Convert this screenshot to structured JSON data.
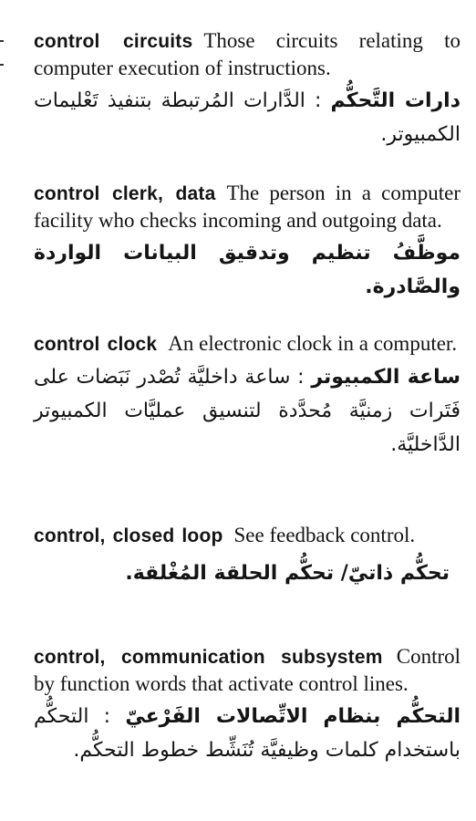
{
  "entries": [
    {
      "term": "control circuits",
      "definition": "Those circuits relating to computer execution of instructions.",
      "arabic_term": "دارات التَّحكُّم",
      "arabic_separator": " : ",
      "arabic_definition": "الدَّارات المُرتبطة بتنفيذ تَعْليمات الكمبيوتر."
    },
    {
      "term": "control clerk, data",
      "definition": "The person in a computer facility who checks incoming and outgoing data.",
      "arabic_term": "",
      "arabic_separator": "",
      "arabic_definition": "موظَّفُ تنظيم وتدقيق البيانات الواردة والصَّادرة."
    },
    {
      "term": "control clock",
      "definition": "An electronic clock in a computer.",
      "arabic_term": "ساعة الكمبيوتر",
      "arabic_separator": " : ",
      "arabic_definition": "ساعة داخليَّة تُصْدر نَبَضات على فَتَرات زمنيَّة مُحدَّدة لتنسيق عمليَّات الكمبيوتر الدَّاخليَّة."
    },
    {
      "term": "control, closed loop",
      "definition": "See feedback control.",
      "arabic_term": "",
      "arabic_separator": "",
      "arabic_definition": "تحكُّم ذاتيّ/ تحكُّم الحلقة المُغْلقة."
    },
    {
      "term": "control, communication subsystem",
      "definition": "Control by function words that activate control lines.",
      "arabic_term": "التحكُّم بنظام الاتِّصالات الفَرْعيّ",
      "arabic_separator": " : ",
      "arabic_definition": "التحكُّم باستخدام كلمات وظيفيَّة تُنَشِّط خطوط التحكُّم."
    }
  ]
}
